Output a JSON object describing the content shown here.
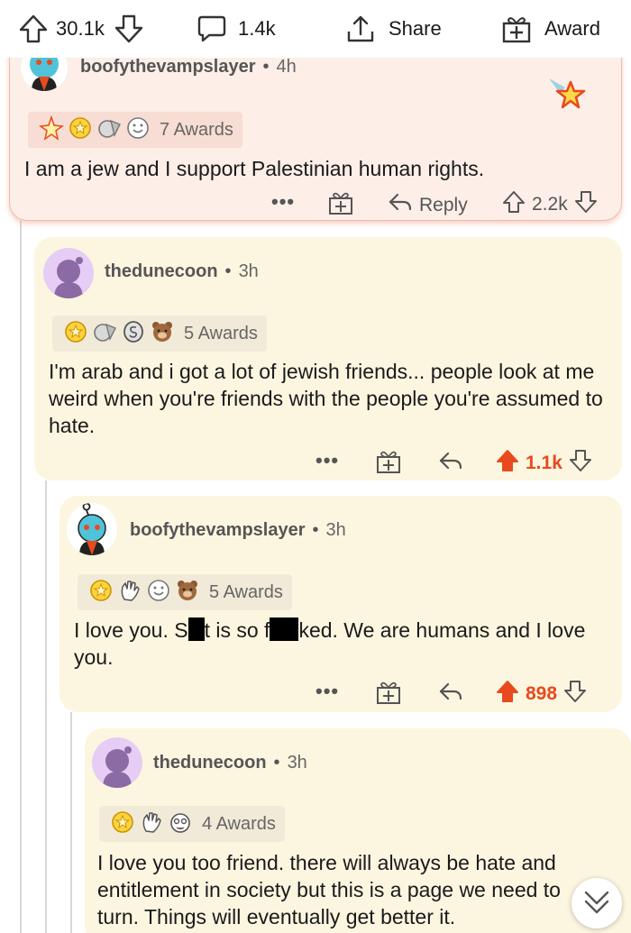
{
  "topbar": {
    "upvotes": "30.1k",
    "comments": "1.4k",
    "share_label": "Share",
    "award_label": "Award"
  },
  "comments": [
    {
      "username": "boofythevampslayer",
      "time": "4h",
      "awards_label": "7 Awards",
      "text": "I am a jew and I support Palestinian human rights.",
      "reply_label": "Reply",
      "score": "2.2k",
      "upvoted": false
    },
    {
      "username": "thedunecoon",
      "time": "3h",
      "awards_label": "5 Awards",
      "text": "I'm arab and i got a lot of jewish friends... people look at me weird when you're friends with the people you're assumed to hate.",
      "score": "1.1k",
      "upvoted": true
    },
    {
      "username": "boofythevampslayer",
      "time": "3h",
      "awards_label": "5 Awards",
      "text_parts": [
        "I love you. S",
        "t is so f",
        "ked. We are humans and I love you."
      ],
      "score": "898",
      "upvoted": true
    },
    {
      "username": "thedunecoon",
      "time": "3h",
      "awards_label": "4 Awards",
      "text": "I love you too friend. there will always be hate and entitlement in society but this is a page we need to turn. Things will eventually get better it."
    }
  ],
  "more_label": "•••",
  "colors": {
    "upvote_accent": "#e8491d",
    "highlight_card": "#fdeee8",
    "nested_card": "#fcf6e0"
  }
}
